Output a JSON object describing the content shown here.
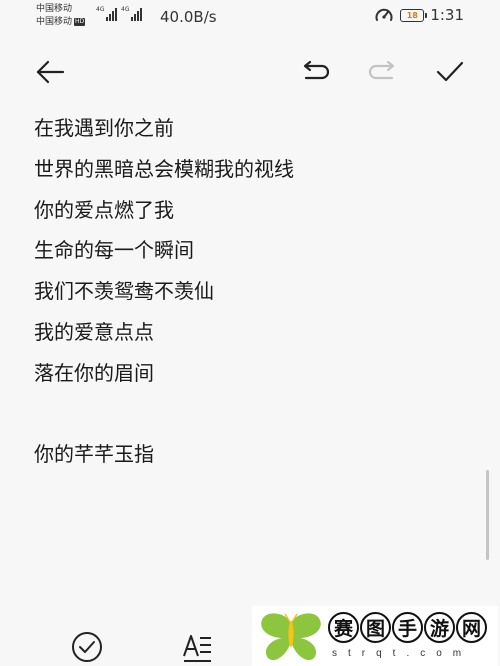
{
  "status_bar": {
    "carrier_1": "中国移动",
    "carrier_2": "中国移动",
    "carrier_2_badge": "HD",
    "signal_tag_1": "4G",
    "signal_tag_2": "4G",
    "net_speed": "40.0B/s",
    "battery_level": "18",
    "time": "1:31"
  },
  "toolbar": {
    "back_icon": "arrow-left-icon",
    "undo_icon": "undo-icon",
    "redo_icon": "redo-icon",
    "done_icon": "check-icon"
  },
  "note": {
    "lines": [
      "在我遇到你之前",
      "世界的黑暗总会模糊我的视线",
      "你的爱点燃了我",
      "生命的每一个瞬间",
      "我们不羡鸳鸯不羡仙",
      "我的爱意点点",
      "落在你的眉间",
      "",
      "你的芊芊玉指"
    ]
  },
  "bottom_bar": {
    "checklist_icon": "check-circle-icon",
    "format_icon": "text-format-icon"
  },
  "watermark": {
    "chars": [
      "赛",
      "图",
      "手",
      "游",
      "网"
    ],
    "domain": "strqt.com"
  },
  "colors": {
    "background": "#f7f7f7",
    "text": "#1a1a1a",
    "icon": "#333333",
    "battery_level": "#d97a1a",
    "watermark_logo": "#8cc63f"
  }
}
